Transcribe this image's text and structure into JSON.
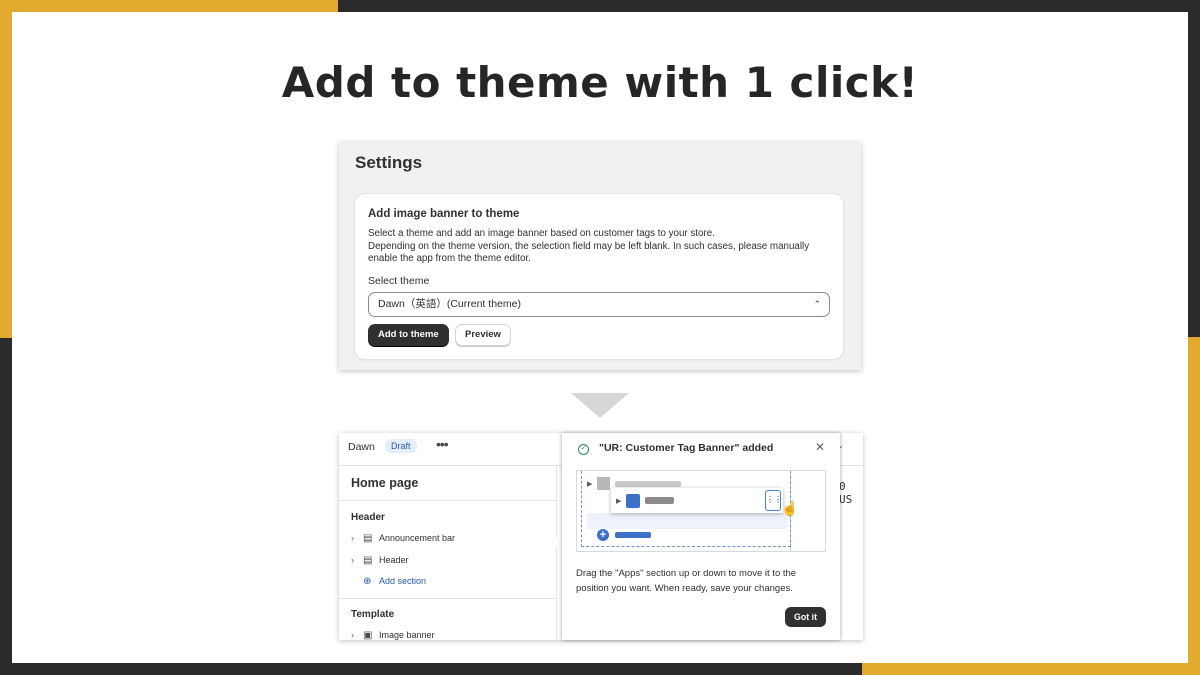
{
  "headline": "Add to theme with 1 click!",
  "colors": {
    "accent": "#e2a92f",
    "frame": "#2b2b2b",
    "primary_button": "#303030",
    "link": "#2a5bb0",
    "success": "#2e8a57"
  },
  "settings": {
    "title": "Settings",
    "card": {
      "title": "Add image banner to theme",
      "description_lines": [
        "Select a theme and add an image banner based on customer tags to your store.",
        "Depending on the theme version, the selection field may be left blank. In such cases, please manually",
        "enable the app from the theme editor."
      ],
      "select_label": "Select theme",
      "select_value": "Dawn（英語）(Current theme)",
      "select_icon": "select-chevrons-icon",
      "primary_button": "Add to theme",
      "secondary_button": "Preview"
    }
  },
  "arrow_icon": "down-triangle-icon",
  "editor": {
    "theme_name": "Dawn",
    "badge": "Draft",
    "more_icon": "ellipsis-icon",
    "page_title": "Home page",
    "groups": [
      {
        "label": "Header",
        "items": [
          {
            "label": "Announcement bar",
            "icon": "section-icon"
          },
          {
            "label": "Header",
            "icon": "section-icon"
          }
        ],
        "add_label": "Add section"
      },
      {
        "label": "Template",
        "items": [
          {
            "label": "Image banner",
            "icon": "image-section-icon"
          }
        ]
      }
    ],
    "preview_text": "0 US"
  },
  "popover": {
    "title": "\"UR: Customer Tag Banner\" added",
    "check_icon": "check-circle-icon",
    "close_icon": "close-icon",
    "illustration": "drag-section-illustration",
    "description": "Drag the \"Apps\" section up or down to move it to the position you want. When ready, save your changes.",
    "button": "Got it"
  }
}
